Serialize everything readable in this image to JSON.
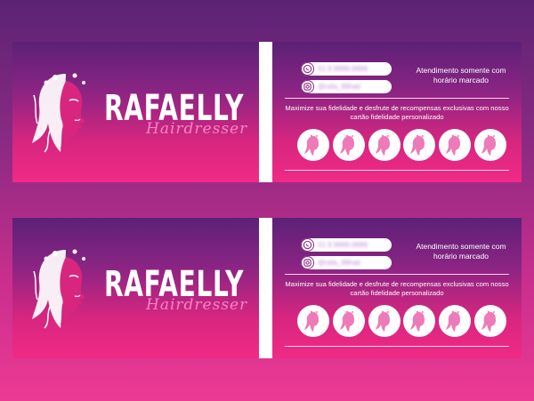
{
  "cards": [
    {
      "brand": "RAFAELLY",
      "subtitle": "Hairdresser",
      "whatsapp": "51 9 9999-9999",
      "instagram": "@rafa_99hair",
      "hours": "Atendimento somente com horário marcado",
      "promo": "Maximize sua fidelidade e desfrute de recompensas exclusivas com nosso cartão fidelidade personalizado",
      "stamp_count": 6
    },
    {
      "brand": "RAFAELLY",
      "subtitle": "Hairdresser",
      "whatsapp": "51 9 9999-9999",
      "instagram": "@rafa_99hair",
      "hours": "Atendimento somente com horário marcado",
      "promo": "Maximize sua fidelidade e desfrute de recompensas exclusivas com nosso cartão fidelidade personalizado",
      "stamp_count": 6
    }
  ],
  "colors": {
    "background_top": "#5b2374",
    "background_bottom": "#ec3a93",
    "card_pink": "#f02a86",
    "card_purple": "#5b2177",
    "accent": "#ff8fcf",
    "white": "#ffffff"
  },
  "icons": [
    "woman-face-logo",
    "whatsapp-icon",
    "instagram-icon",
    "stamp-face-icon"
  ]
}
